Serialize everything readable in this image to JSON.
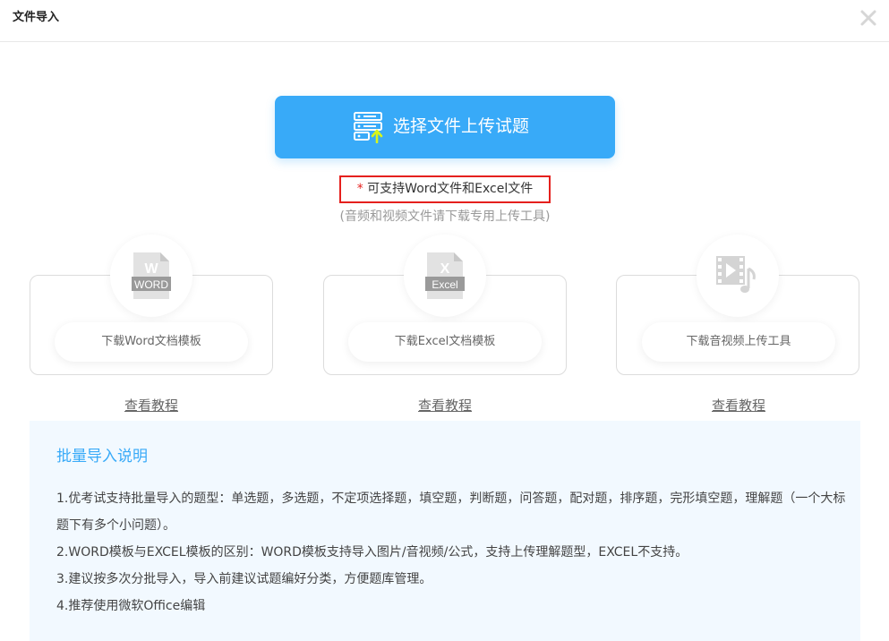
{
  "dialog": {
    "title": "文件导入"
  },
  "upload": {
    "button_label": "选择文件上传试题",
    "support_star": "*",
    "support_text": " 可支持Word文件和Excel文件",
    "sub_note": "(音频和视频文件请下载专用上传工具)"
  },
  "cards": [
    {
      "icon": "word-file-icon",
      "icon_text": "WORD",
      "button_label": "下载Word文档模板",
      "link_label": "查看教程"
    },
    {
      "icon": "excel-file-icon",
      "icon_text": "Excel",
      "button_label": "下载Excel文档模板",
      "link_label": "查看教程"
    },
    {
      "icon": "video-file-icon",
      "button_label": "下载音视频上传工具",
      "link_label": "查看教程"
    }
  ],
  "instructions": {
    "title": "批量导入说明",
    "items": [
      "1.优考试支持批量导入的题型：单选题，多选题，不定项选择题，填空题，判断题，问答题，配对题，排序题，完形填空题，理解题（一个大标题下有多个小问题）。",
      "2.WORD模板与EXCEL模板的区别：WORD模板支持导入图片/音视频/公式，支持上传理解题型，EXCEL不支持。",
      "3.建议按多次分批导入，导入前建议试题编好分类，方便题库管理。",
      "4.推荐使用微软Office编辑"
    ]
  },
  "colors": {
    "accent": "#38aaf8",
    "highlight_border": "#e5201d",
    "panel_bg": "#f2f9ff"
  }
}
